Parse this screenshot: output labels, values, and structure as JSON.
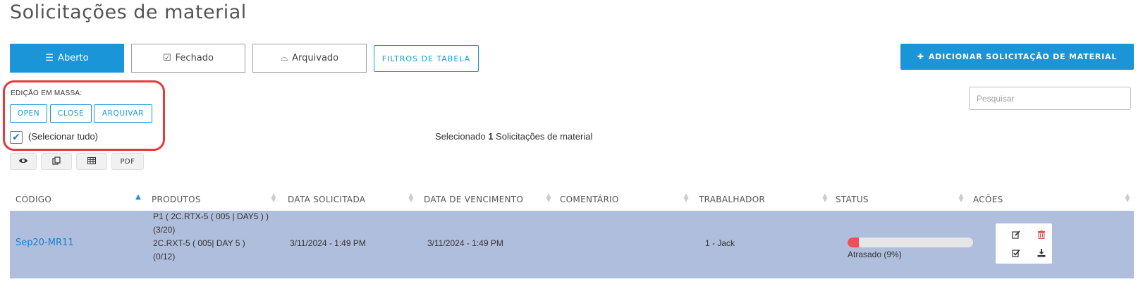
{
  "page": {
    "title": "Solicitações de material"
  },
  "tabs": [
    {
      "label": "Aberto",
      "icon": "list-icon",
      "active": true
    },
    {
      "label": "Fechado",
      "icon": "checkbox-icon",
      "active": false
    },
    {
      "label": "Arquivado",
      "icon": "inbox-icon",
      "active": false
    }
  ],
  "filters_button": {
    "label": "FILTROS DE TABELA"
  },
  "add_button": {
    "label": "ADICIONAR SOLICITAÇÃO DE MATERIAL",
    "icon": "plus-icon"
  },
  "bulk_edit": {
    "label": "EDIÇÃO EM MASSA:",
    "open_label": "OPEN",
    "close_label": "CLOSE",
    "archive_label": "ARQUIVAR",
    "select_all_label": "(Selecionar tudo)",
    "select_all_checked": true
  },
  "selection": {
    "prefix": "Selecionado",
    "count": "1",
    "suffix": "Solicitações de material"
  },
  "search": {
    "placeholder": "Pesquisar",
    "value": ""
  },
  "toolbar": {
    "view_icon": "eye-icon",
    "copy_icon": "copy-icon",
    "table_icon": "table-icon",
    "pdf_label": "PDF"
  },
  "table": {
    "columns": [
      "CÓDIGO",
      "PRODUTOS",
      "DATA SOLICITADA",
      "DATA DE VENCIMENTO",
      "COMENTÁRIO",
      "TRABALHADOR",
      "STATUS",
      "ACÕES"
    ],
    "sorted_column": "CÓDIGO",
    "rows": [
      {
        "code": "Sep20-MR11",
        "products": [
          "P1 ( 2C.RTX-5 ( 005 | DAY5 ) )",
          "(3/20)",
          "2C.RXT-5 ( 005| DAY 5 )",
          "(0/12)"
        ],
        "date_requested": "3/11/2024 - 1:49 PM",
        "due_date": "3/11/2024 - 1:49 PM",
        "comment": "",
        "worker": "1 - Jack",
        "status_text": "Atrasado (9%)",
        "status_progress_percent": 9,
        "status_color": "#ef4f57",
        "selected": true
      }
    ]
  },
  "colors": {
    "accent": "#1a96d8",
    "row_selected": "#b0bedd",
    "highlight_border": "#e8383d",
    "danger": "#e04848"
  }
}
